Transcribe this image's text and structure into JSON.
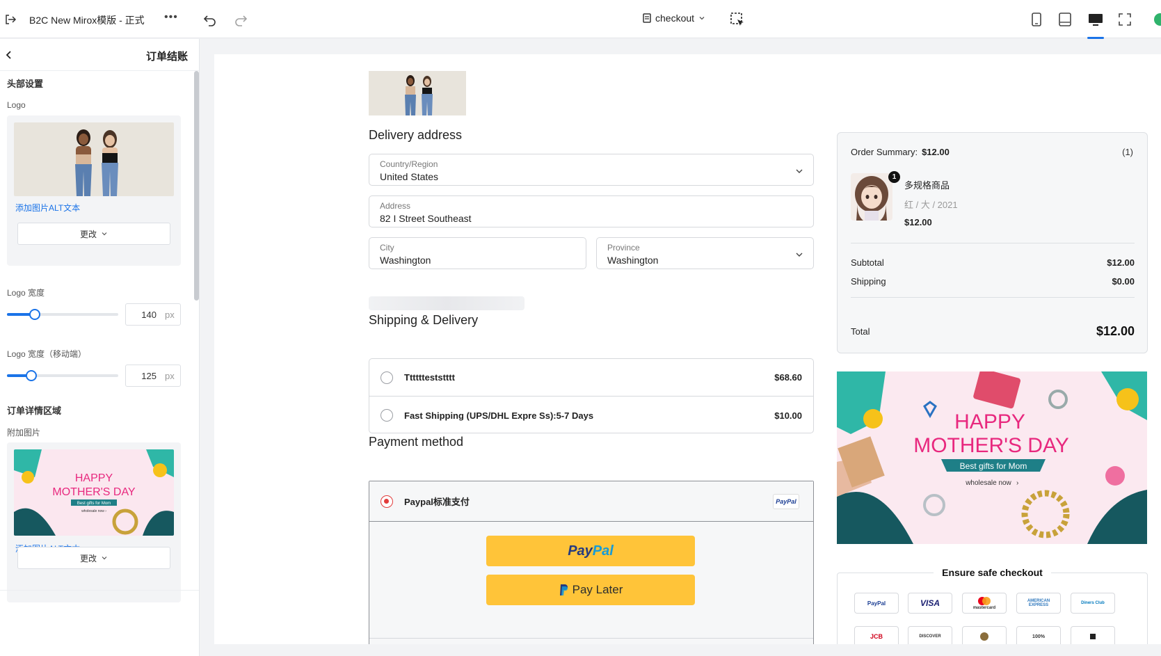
{
  "topbar": {
    "title": "B2C New Mirox模版 - 正式",
    "more": "•••",
    "page_name": "checkout",
    "devices": [
      "mobile",
      "tablet",
      "desktop",
      "fullscreen"
    ],
    "active_device": "desktop"
  },
  "left_panel": {
    "title": "订单结账",
    "header_section": "头部设置",
    "logo_label": "Logo",
    "logo_alt_link": "添加图片ALT文本",
    "change_label": "更改",
    "logo_width_label": "Logo 宽度",
    "logo_width_value": "140",
    "logo_width_fraction": 0.25,
    "logo_width_mobile_label": "Logo 宽度（移动端）",
    "logo_width_mobile_value": "125",
    "logo_width_mobile_fraction": 0.22,
    "unit": "px",
    "order_section": "订单详情区域",
    "attach_label": "附加图片",
    "attach_alt_link": "添加图片ALT文本",
    "attach_change_label": "更改"
  },
  "checkout": {
    "delivery_title": "Delivery address",
    "country_label": "Country/Region",
    "country_value": "United States",
    "address_label": "Address",
    "address_value": "82 I Street Southeast",
    "city_label": "City",
    "city_value": "Washington",
    "province_label": "Province",
    "province_value": "Washington",
    "shipping_title": "Shipping & Delivery",
    "shipping_options": [
      {
        "name": "Tttttteststttt",
        "price": "$68.60"
      },
      {
        "name": "Fast Shipping (UPS/DHL Expre Ss):5-7 Days",
        "price": "$10.00"
      }
    ],
    "payment_title": "Payment method",
    "payment_option": "Paypal标准支付",
    "paypal_badge": "PayPal",
    "paypal_btn_a": "Pay",
    "paypal_btn_b": "Pal",
    "paylater_btn": "Pay Later"
  },
  "summary": {
    "label": "Order Summary:",
    "amount": "$12.00",
    "count": "(1)",
    "product_qty": "1",
    "product_name": "多规格商品",
    "product_variant": "红 / 大 / 2021",
    "product_price": "$12.00",
    "subtotal_label": "Subtotal",
    "subtotal_value": "$12.00",
    "shipping_label": "Shipping",
    "shipping_value": "$0.00",
    "total_label": "Total",
    "total_value": "$12.00"
  },
  "banner": {
    "line1": "HAPPY",
    "line2": "MOTHER'S DAY",
    "ribbon": "Best gifts for Mom",
    "cta": "wholesale now"
  },
  "safe_checkout": {
    "title": "Ensure safe checkout",
    "cards": [
      "PayPal",
      "VISA",
      "mastercard",
      "AMERICAN EXPRESS",
      "Diners Club",
      "JCB",
      "DISCOVER",
      "",
      "100%",
      ""
    ]
  },
  "colors": {
    "accent": "#1a73e8",
    "radio_active": "#e23b3b",
    "paypal_yellow": "#ffc439",
    "paypal_navy": "#253b80",
    "paypal_sky": "#179bd7"
  }
}
